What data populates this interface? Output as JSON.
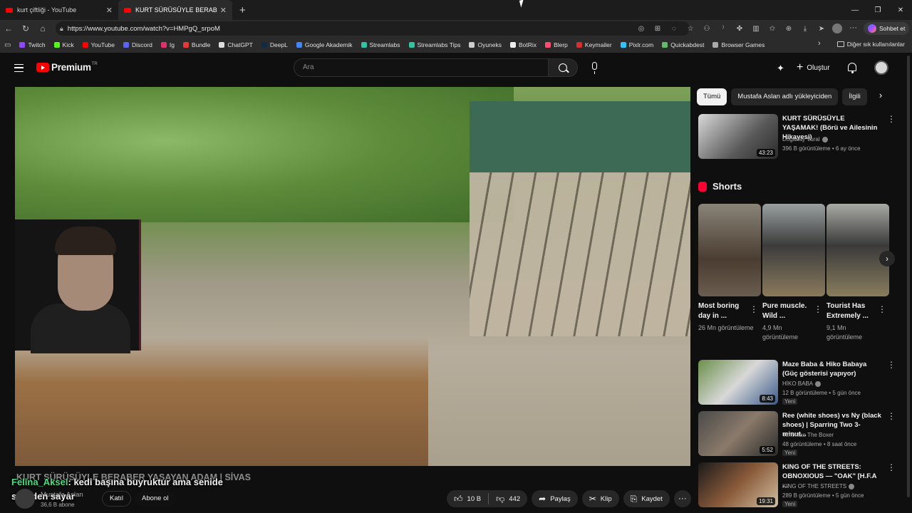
{
  "browser": {
    "tabs": [
      {
        "title": "kurt çiftliği - YouTube",
        "active": false
      },
      {
        "title": "KURT SÜRÜSÜYLE BERABER YAŞAYAN ADAM",
        "active": true
      }
    ],
    "url": "https://www.youtube.com/watch?v=HMPgQ_srpoM",
    "copilot_label": "Sohbet et",
    "bookmarks": [
      {
        "label": "Twitch",
        "color": "#9146ff"
      },
      {
        "label": "Kick",
        "color": "#53fc18"
      },
      {
        "label": "YouTube",
        "color": "#ff0000"
      },
      {
        "label": "Discord",
        "color": "#5865f2"
      },
      {
        "label": "Ig",
        "color": "#e1306c"
      },
      {
        "label": "Bundle",
        "color": "#e53935"
      },
      {
        "label": "ChatGPT",
        "color": "#dddddd"
      },
      {
        "label": "DeepL",
        "color": "#0f2b46"
      },
      {
        "label": "Google Akademik",
        "color": "#4285f4"
      },
      {
        "label": "Streamlabs",
        "color": "#31c3a2"
      },
      {
        "label": "Streamlabs Tips",
        "color": "#31c3a2"
      },
      {
        "label": "Oyuneks",
        "color": "#cccccc"
      },
      {
        "label": "BotRix",
        "color": "#eeeeee"
      },
      {
        "label": "Blerp",
        "color": "#ff4d6d"
      },
      {
        "label": "Keymailer",
        "color": "#d32f2f"
      },
      {
        "label": "Pixlr.com",
        "color": "#2ec5ff"
      },
      {
        "label": "Quickabdest",
        "color": "#66bb6a"
      },
      {
        "label": "Browser Games",
        "color": "#aaaaaa"
      }
    ],
    "other_bookmarks": "Diğer sık kullanılanlar"
  },
  "youtube": {
    "logo": "Premium",
    "logo_region": "TR",
    "search_placeholder": "Ara",
    "create_label": "Oluştur"
  },
  "video": {
    "title": "KURT SÜRÜSÜYLE BERABER YAŞAYAN ADAM | SİVAS",
    "chat_user": "Felina_Aksel",
    "chat_message": ": kedi başına buyruktur ama senide sürüden sayar",
    "channel": "Mustafa Aslan",
    "subscribers": "36,6 B abone",
    "join_label": "Katıl",
    "subscribe_label": "Abone ol",
    "likes": "10 B",
    "dislikes": "442",
    "share_label": "Paylaş",
    "clip_label": "Klip",
    "save_label": "Kaydet"
  },
  "sidebar": {
    "chips": [
      "Tümü",
      "Mustafa Aslan adlı yükleyiciden",
      "İlgili"
    ],
    "videos": [
      {
        "title": "KURT SÜRÜSÜYLE YAŞAMAK! (Börü ve Ailesinin Hikayesi)",
        "channel": "Doğanay Vural",
        "meta": "396 B görüntüleme • 6 ay önce",
        "duration": "43:23",
        "new": false
      },
      {
        "title": "Maze Baba & Hiko Babaya (Güç gösterisi yapıyor)",
        "channel": "HİKO BABA",
        "meta": "12 B görüntüleme • 5 gün önce",
        "duration": "8:43",
        "new": true
      },
      {
        "title": "Ree (white shoes) vs Ny (black shoes) | Sparring Two 3-minut...",
        "channel": "Timontae The Boxer",
        "meta": "48 görüntüleme • 8 saat önce",
        "duration": "5:52",
        "new": true
      },
      {
        "title": "KING OF THE STREETS: OBNOXIOUS — \"OAK\" [H.F.A ...",
        "channel": "KING OF THE STREETS",
        "meta": "289 B görüntüleme • 5 gün önce",
        "duration": "19:31",
        "new": true
      }
    ],
    "new_label": "Yeni",
    "shorts_title": "Shorts",
    "shorts": [
      {
        "title": "Most boring day in ...",
        "views": "26 Mn görüntüleme"
      },
      {
        "title": "Pure muscle. Wild ...",
        "views": "4,9 Mn görüntüleme"
      },
      {
        "title": "Tourist Has Extremely ...",
        "views": "9,1 Mn görüntüleme"
      }
    ]
  }
}
